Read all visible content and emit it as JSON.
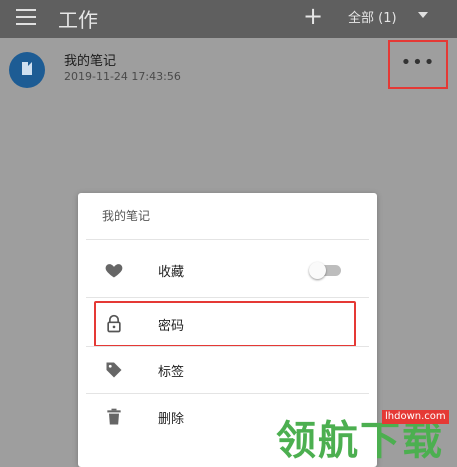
{
  "topbar": {
    "title": "工作",
    "filter_label": "全部 (1)",
    "icons": [
      "menu-icon",
      "add-icon",
      "chevron-down-icon"
    ]
  },
  "note": {
    "title": "我的笔记",
    "timestamp": "2019-11-24 17:43:56",
    "more_label": "•••",
    "icons": [
      "document-icon",
      "more-icon"
    ]
  },
  "menu": {
    "header": "我的笔记",
    "items": [
      {
        "label": "收藏",
        "icon": "heart-icon",
        "toggle_on": false
      },
      {
        "label": "密码",
        "icon": "lock-icon"
      },
      {
        "label": "标签",
        "icon": "tag-icon"
      },
      {
        "label": "删除",
        "icon": "trash-icon"
      }
    ]
  },
  "watermark": {
    "url": "lhdown.com",
    "text": "领航下载"
  },
  "colors": {
    "accent_red": "#e53935",
    "avatar_blue": "#1d5c94",
    "watermark_green": "#4caf50"
  }
}
